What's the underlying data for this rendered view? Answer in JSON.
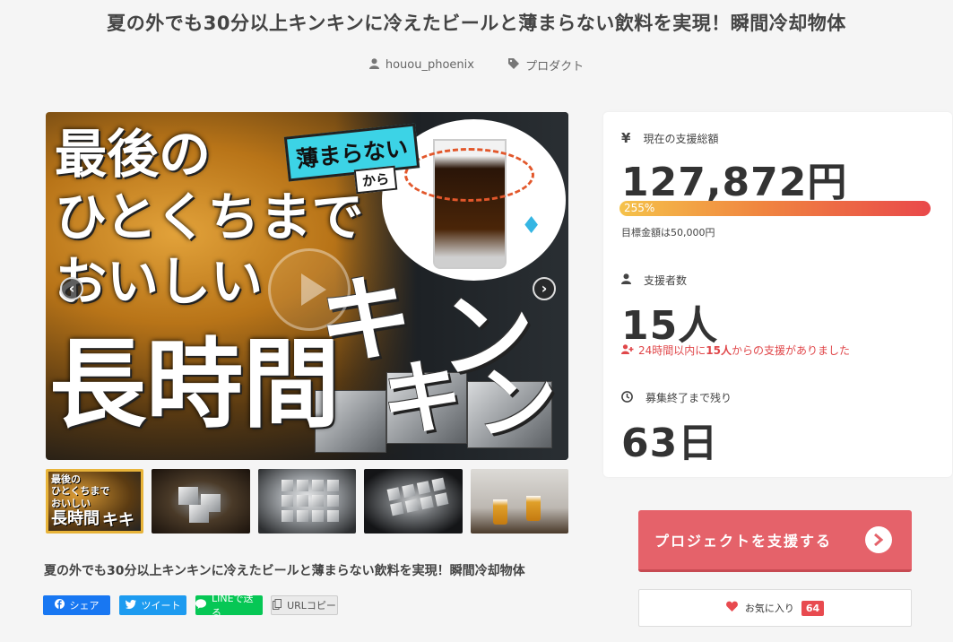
{
  "title": "夏の外でも30分以上キンキンに冷えたビールと薄まらない飲料を実現！瞬間冷却物体",
  "meta": {
    "author": "houou_phoenix",
    "category": "プロダクト"
  },
  "hero_image": {
    "line1": "最後の",
    "line2": "ひとくちまで",
    "line3": "おいしい",
    "line4": "長時間",
    "kin1": "キ",
    "kin2": "ン",
    "kin3": "キ",
    "kin4": "ン",
    "badge_main": "薄まらない",
    "badge_sub": "から",
    "drop": "♦"
  },
  "thumbnails": {
    "t1": "最後の",
    "t2": "ひとくちまで",
    "t3": "おいしい",
    "t4": "長時間",
    "t5": "キキ"
  },
  "description": "夏の外でも30分以上キンキンに冷えたビールと薄まらない飲料を実現！瞬間冷却物体",
  "share": {
    "facebook": "シェア",
    "twitter": "ツイート",
    "line": "LINEで送る",
    "copy": "URLコピー"
  },
  "stats": {
    "total_label": "現在の支援総額",
    "total_value": "127,872円",
    "progress_text": "255%",
    "progress_value": 2.55,
    "target": "目標金額は50,000円",
    "supporters_label": "支援者数",
    "supporters_value": "15人",
    "recent_pre": "24時間以内に",
    "recent_num": "15人",
    "recent_post": "からの支援がありました",
    "remaining_label": "募集終了まで残り",
    "remaining_value": "63日"
  },
  "cta_label": "プロジェクトを支援する",
  "favorite": {
    "label": "お気に入り",
    "count": "64"
  },
  "colors": {
    "cta": "#e5626a",
    "favorite_count": "#e84a4f",
    "facebook": "#1877f2",
    "twitter": "#1d9bf0",
    "line": "#06c755"
  }
}
